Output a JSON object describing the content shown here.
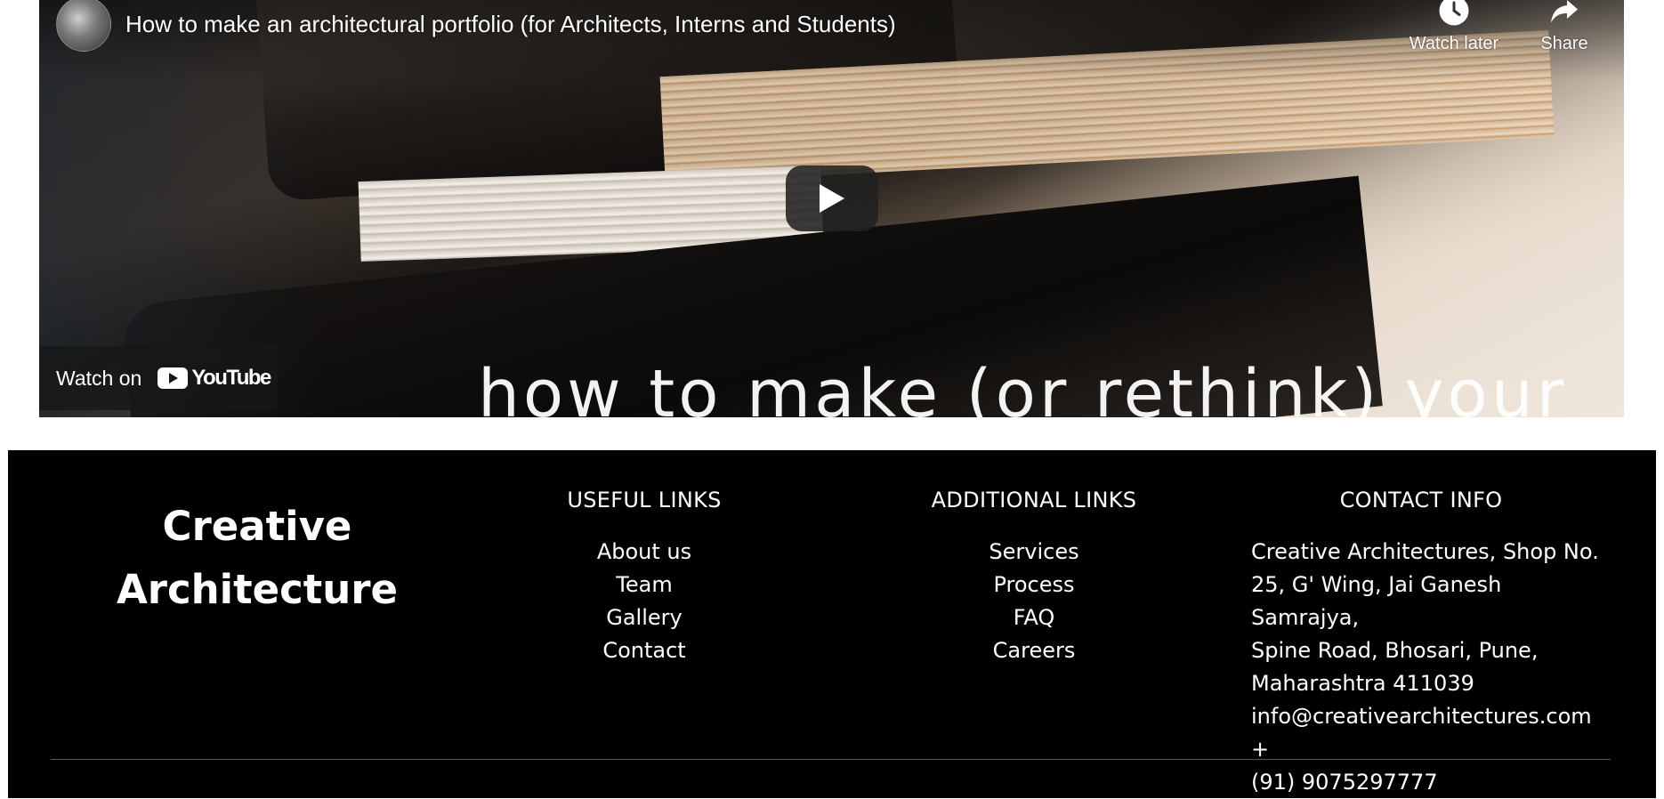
{
  "video": {
    "title": "How to make an architectural portfolio (for Architects, Interns and Students)",
    "watch_later_label": "Watch later",
    "share_label": "Share",
    "watch_on_label": "Watch on",
    "youtube_wordmark": "YouTube",
    "overlay_text": "how to make (or rethink) your",
    "icons": {
      "avatar": "channel-avatar",
      "watch_later": "clock-icon",
      "share": "share-arrow-icon",
      "play": "play-icon",
      "youtube": "youtube-logo-icon"
    }
  },
  "footer": {
    "brand_line1": "Creative",
    "brand_line2": "Architecture",
    "useful_links": {
      "heading": "USEFUL LINKS",
      "items": [
        "About us",
        "Team",
        "Gallery",
        "Contact"
      ]
    },
    "additional_links": {
      "heading": "ADDITIONAL LINKS",
      "items": [
        "Services",
        "Process",
        "FAQ",
        "Careers"
      ]
    },
    "contact_info": {
      "heading": "CONTACT INFO",
      "lines": [
        "Creative Architectures, Shop No.",
        "25, G' Wing, Jai Ganesh Samrajya,",
        "Spine Road, Bhosari, Pune,",
        "Maharashtra 411039",
        "info@creativearchitectures.com +",
        "(91) 9075297777"
      ]
    }
  },
  "colors": {
    "footer_bg": "#000000",
    "footer_text": "#ffffff",
    "play_button_bg": "#212121",
    "youtube_red": "#ffffff"
  }
}
